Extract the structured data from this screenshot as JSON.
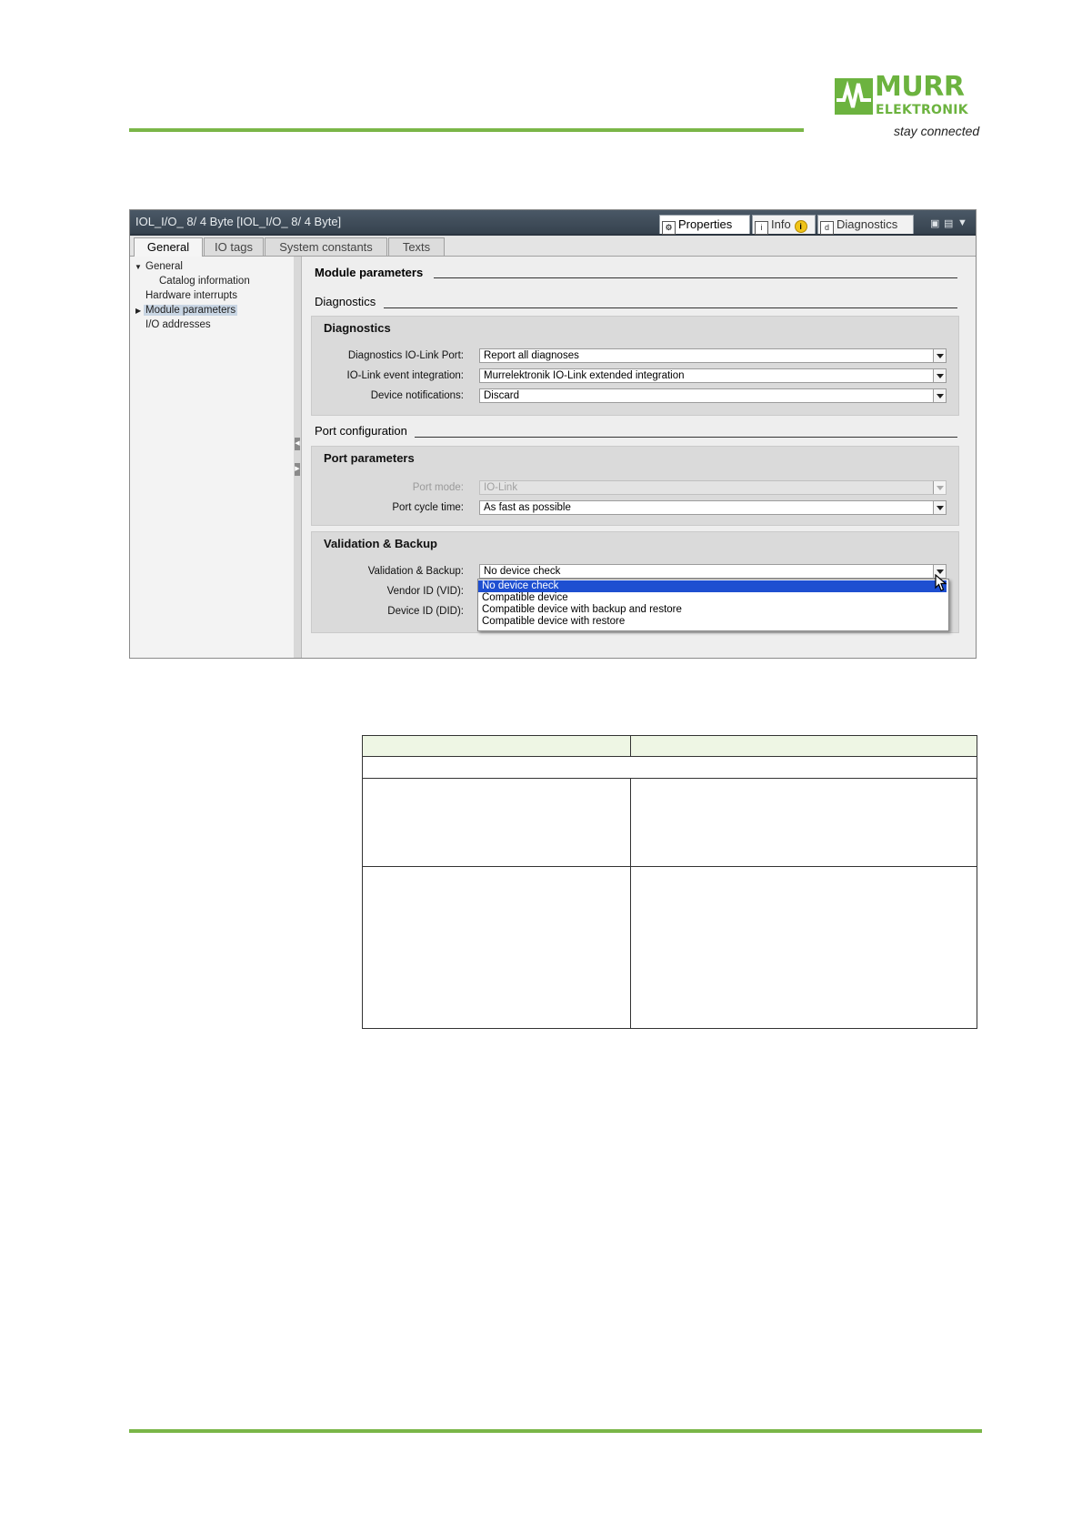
{
  "logo": {
    "brand_line1": "MURR",
    "brand_line2": "ELEKTRONIK",
    "tagline": "stay connected",
    "color": "#6cb33f"
  },
  "window": {
    "title": "IOL_I/O_ 8/ 4 Byte [IOL_I/O_ 8/ 4 Byte]",
    "top_tabs": [
      {
        "label": "Properties",
        "icon": "properties-icon",
        "active": true
      },
      {
        "label": "Info",
        "icon": "info-icon",
        "badge": "i",
        "active": false
      },
      {
        "label": "Diagnostics",
        "icon": "diagnostics-icon",
        "active": false
      }
    ],
    "sub_tabs": [
      "General",
      "IO tags",
      "System constants",
      "Texts"
    ],
    "nav": {
      "general": "General",
      "catalog": "Catalog information",
      "hardware": "Hardware interrupts",
      "module": "Module parameters",
      "io": "I/O addresses"
    }
  },
  "content": {
    "heading": "Module parameters",
    "diagnostics_section": "Diagnostics",
    "diagnostics_group": {
      "title": "Diagnostics",
      "fields": [
        {
          "label": "Diagnostics IO-Link Port:",
          "value": "Report all diagnoses"
        },
        {
          "label": "IO-Link event integration:",
          "value": "Murrelektronik IO-Link extended integration"
        },
        {
          "label": "Device notifications:",
          "value": "Discard"
        }
      ]
    },
    "port_section": "Port configuration",
    "port_group": {
      "title": "Port parameters",
      "fields": [
        {
          "label": "Port mode:",
          "value": "IO-Link",
          "disabled": true
        },
        {
          "label": "Port cycle time:",
          "value": "As fast as possible",
          "disabled": false
        }
      ]
    },
    "validation_group": {
      "title": "Validation & Backup",
      "label_validation": "Validation & Backup:",
      "value_validation": "No device check",
      "label_vendor": "Vendor ID (VID):",
      "label_device": "Device ID (DID):",
      "dropdown_options": [
        "No device check",
        "Compatible device",
        "Compatible device with backup and restore",
        "Compatible device with restore"
      ],
      "highlight_color": "#1e4fd1"
    }
  },
  "accent_green": "#7ab648"
}
